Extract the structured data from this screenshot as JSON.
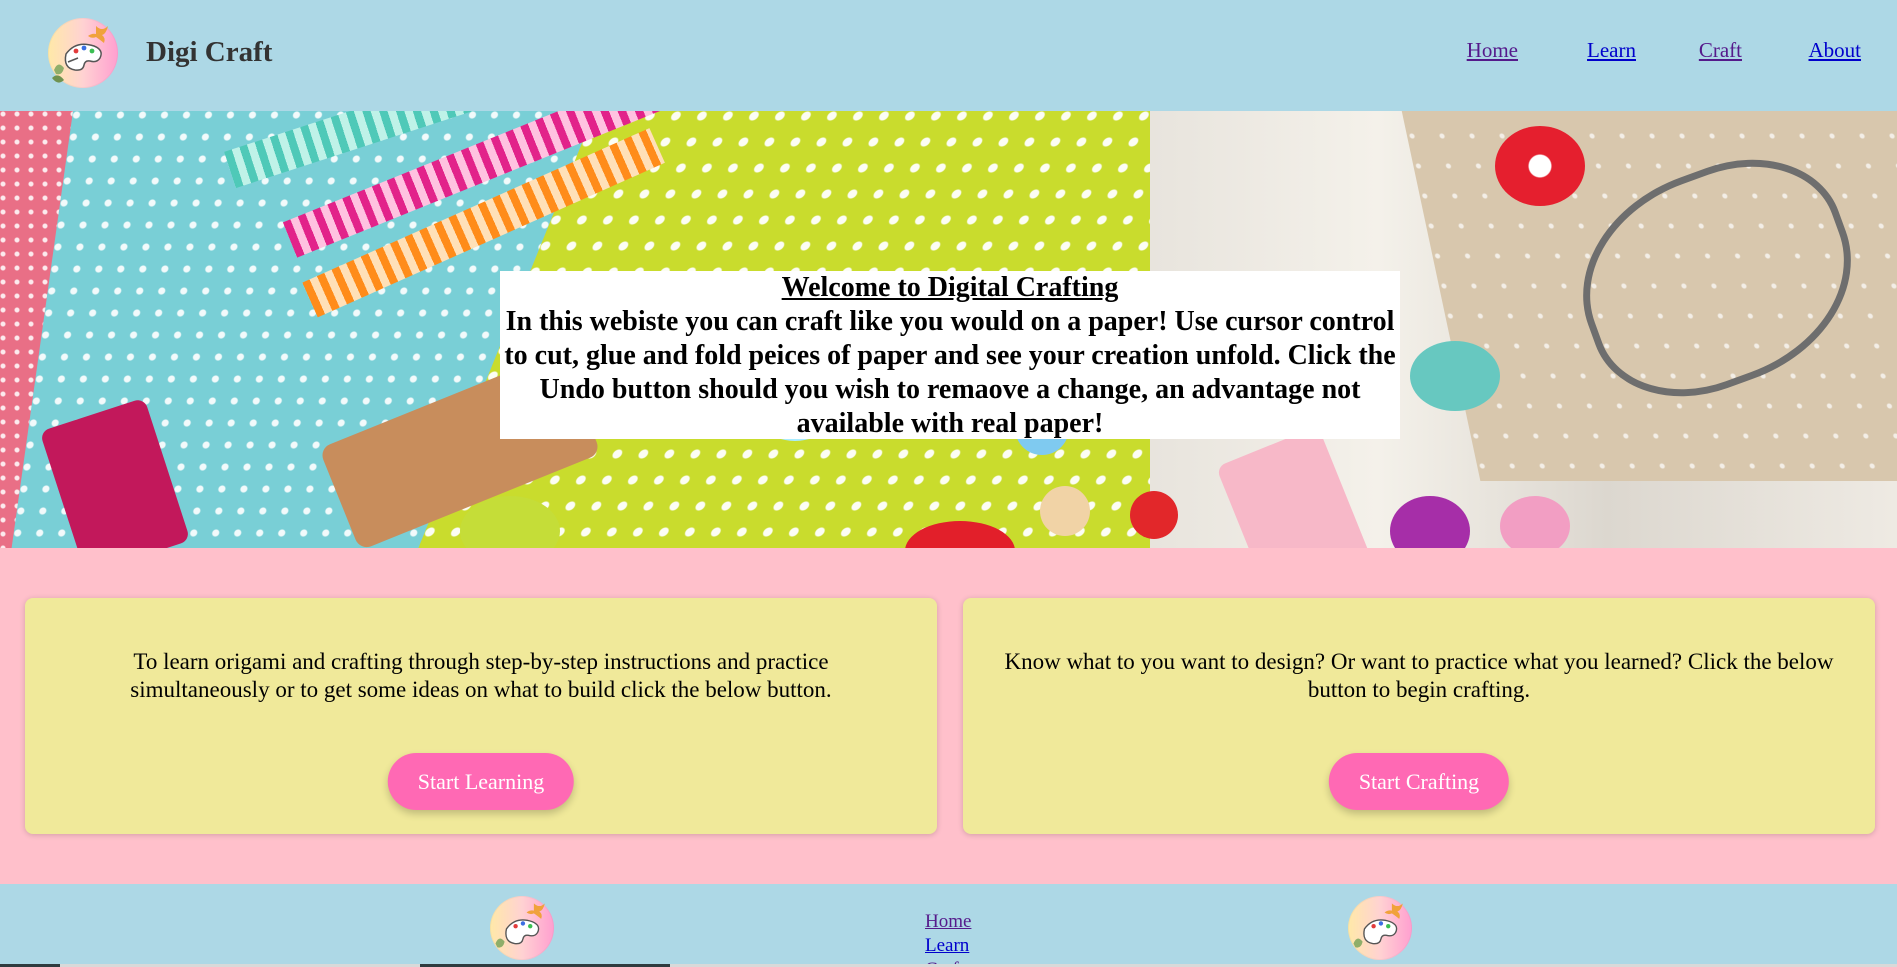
{
  "header": {
    "brand": "Digi Craft",
    "nav": [
      {
        "label": "Home"
      },
      {
        "label": "Learn"
      },
      {
        "label": "Craft"
      },
      {
        "label": "About"
      }
    ]
  },
  "hero": {
    "title": "Welcome to Digital Crafting",
    "body": "In this webiste you can craft like you would on a paper! Use cursor control to cut, glue and fold peices of paper and see your creation unfold. Click the Undo button should you wish to remaove a change, an advantage not available with real paper!"
  },
  "cards": [
    {
      "text": "To learn origami and crafting through step-by-step instructions and practice simultaneously or to get some ideas on what to build click the below button.",
      "button": "Start Learning"
    },
    {
      "text": "Know what to you want to design? Or want to practice what you learned? Click the below button to begin crafting.",
      "button": "Start Crafting"
    }
  ],
  "footer": {
    "links": [
      {
        "label": "Home"
      },
      {
        "label": "Learn"
      },
      {
        "label": "Craft"
      }
    ]
  },
  "colors": {
    "header_bg": "#add8e6",
    "page_bg": "#ffc0cb",
    "card_bg": "#f0e99a",
    "button_bg": "#ff69b4"
  },
  "icons": {
    "logo": "palette-logo-icon"
  }
}
